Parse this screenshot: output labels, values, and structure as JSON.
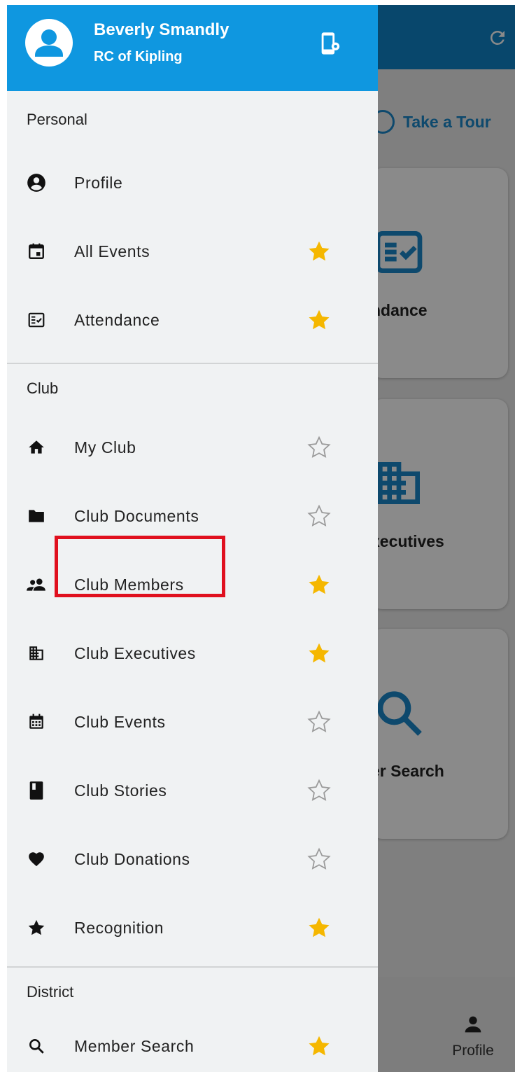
{
  "drawer": {
    "user_name": "Beverly Smandly",
    "user_club": "RC of Kipling",
    "sections": [
      {
        "title": "Personal",
        "items": [
          {
            "label": "Profile",
            "icon": "account-circle-icon",
            "favorite": null
          },
          {
            "label": "All Events",
            "icon": "calendar-icon",
            "favorite": true
          },
          {
            "label": "Attendance",
            "icon": "attendance-icon",
            "favorite": true
          }
        ]
      },
      {
        "title": "Club",
        "items": [
          {
            "label": "My Club",
            "icon": "home-icon",
            "favorite": false
          },
          {
            "label": "Club Documents",
            "icon": "folder-icon",
            "favorite": false
          },
          {
            "label": "Club Members",
            "icon": "people-icon",
            "favorite": true
          },
          {
            "label": "Club Executives",
            "icon": "building-icon",
            "favorite": true
          },
          {
            "label": "Club Events",
            "icon": "calendar-grid-icon",
            "favorite": false
          },
          {
            "label": "Club Stories",
            "icon": "book-icon",
            "favorite": false
          },
          {
            "label": "Club Donations",
            "icon": "heart-icon",
            "favorite": false
          },
          {
            "label": "Recognition",
            "icon": "star-filled-icon",
            "favorite": true
          }
        ]
      },
      {
        "title": "District",
        "items": [
          {
            "label": "Member Search",
            "icon": "search-icon",
            "favorite": true
          }
        ]
      }
    ]
  },
  "background": {
    "tour_label": "Take a Tour",
    "cards": [
      "ndance",
      "xecutives",
      "er Search"
    ],
    "bottom_nav_profile": "Profile"
  },
  "colors": {
    "header_blue": "#0f97e0",
    "star_gold": "#f5b700",
    "highlight_red": "#e0101e"
  }
}
